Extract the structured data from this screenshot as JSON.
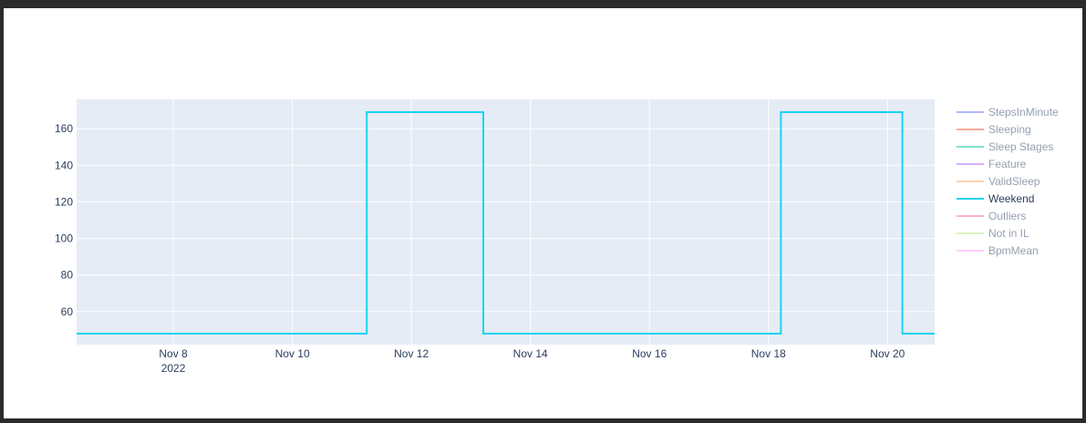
{
  "chart_data": {
    "type": "line",
    "line_shape": "step",
    "title": "",
    "xlabel": "",
    "ylabel": "",
    "x_range": [
      "2022-11-06 09:00",
      "2022-11-20 19:00"
    ],
    "ylim": [
      42,
      176
    ],
    "grid": true,
    "legend_position": "right",
    "x_ticks": [
      {
        "date": "2022-11-08",
        "label": "Nov 8",
        "sublabel": "2022"
      },
      {
        "date": "2022-11-10",
        "label": "Nov 10"
      },
      {
        "date": "2022-11-12",
        "label": "Nov 12"
      },
      {
        "date": "2022-11-14",
        "label": "Nov 14"
      },
      {
        "date": "2022-11-16",
        "label": "Nov 16"
      },
      {
        "date": "2022-11-18",
        "label": "Nov 18"
      },
      {
        "date": "2022-11-20",
        "label": "Nov 20"
      }
    ],
    "y_ticks": [
      60,
      80,
      100,
      120,
      140,
      160
    ],
    "series": [
      {
        "name": "StepsInMinute",
        "color": "#636efa",
        "visible": false,
        "points": []
      },
      {
        "name": "Sleeping",
        "color": "#ef553b",
        "visible": false,
        "points": []
      },
      {
        "name": "Sleep Stages",
        "color": "#00cc96",
        "visible": false,
        "points": []
      },
      {
        "name": "Feature",
        "color": "#ab63fa",
        "visible": false,
        "points": []
      },
      {
        "name": "ValidSleep",
        "color": "#ffa15a",
        "visible": false,
        "points": []
      },
      {
        "name": "Weekend",
        "color": "#19d3f3",
        "visible": true,
        "points": [
          {
            "x": "2022-11-06 09:00",
            "y": 48
          },
          {
            "x": "2022-11-11 06:00",
            "y": 169
          },
          {
            "x": "2022-11-13 05:00",
            "y": 48
          },
          {
            "x": "2022-11-18 05:00",
            "y": 169
          },
          {
            "x": "2022-11-20 06:00",
            "y": 48
          },
          {
            "x": "2022-11-20 19:00",
            "y": 48
          }
        ]
      },
      {
        "name": "Outliers",
        "color": "#ff6692",
        "visible": false,
        "points": []
      },
      {
        "name": "Not in IL",
        "color": "#b6e880",
        "visible": false,
        "points": []
      },
      {
        "name": "BpmMean",
        "color": "#ff97ff",
        "visible": false,
        "points": []
      }
    ]
  }
}
